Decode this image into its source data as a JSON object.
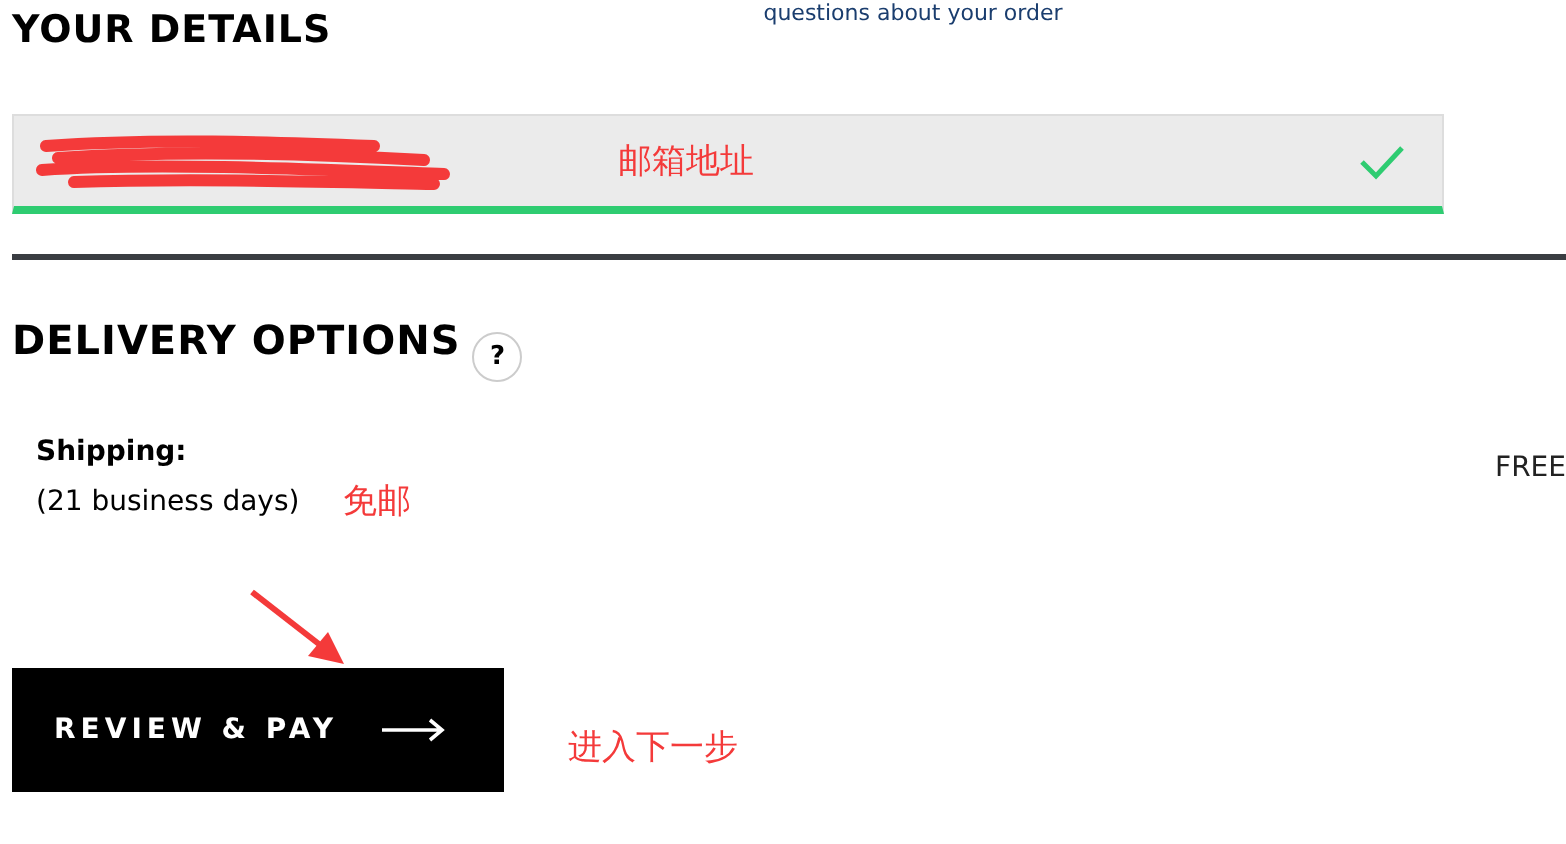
{
  "top_note": "questions about your order",
  "details": {
    "title": "YOUR DETAILS",
    "email_field": {
      "redacted": true,
      "valid": true,
      "annotation": "邮箱地址"
    }
  },
  "delivery": {
    "title": "DELIVERY OPTIONS",
    "help": "?",
    "option": {
      "label": "Shipping:",
      "duration": "(21 business days)",
      "annotation": "免邮",
      "price": "FREE"
    }
  },
  "action": {
    "button": "REVIEW & PAY",
    "annotation": "进入下一步"
  }
}
